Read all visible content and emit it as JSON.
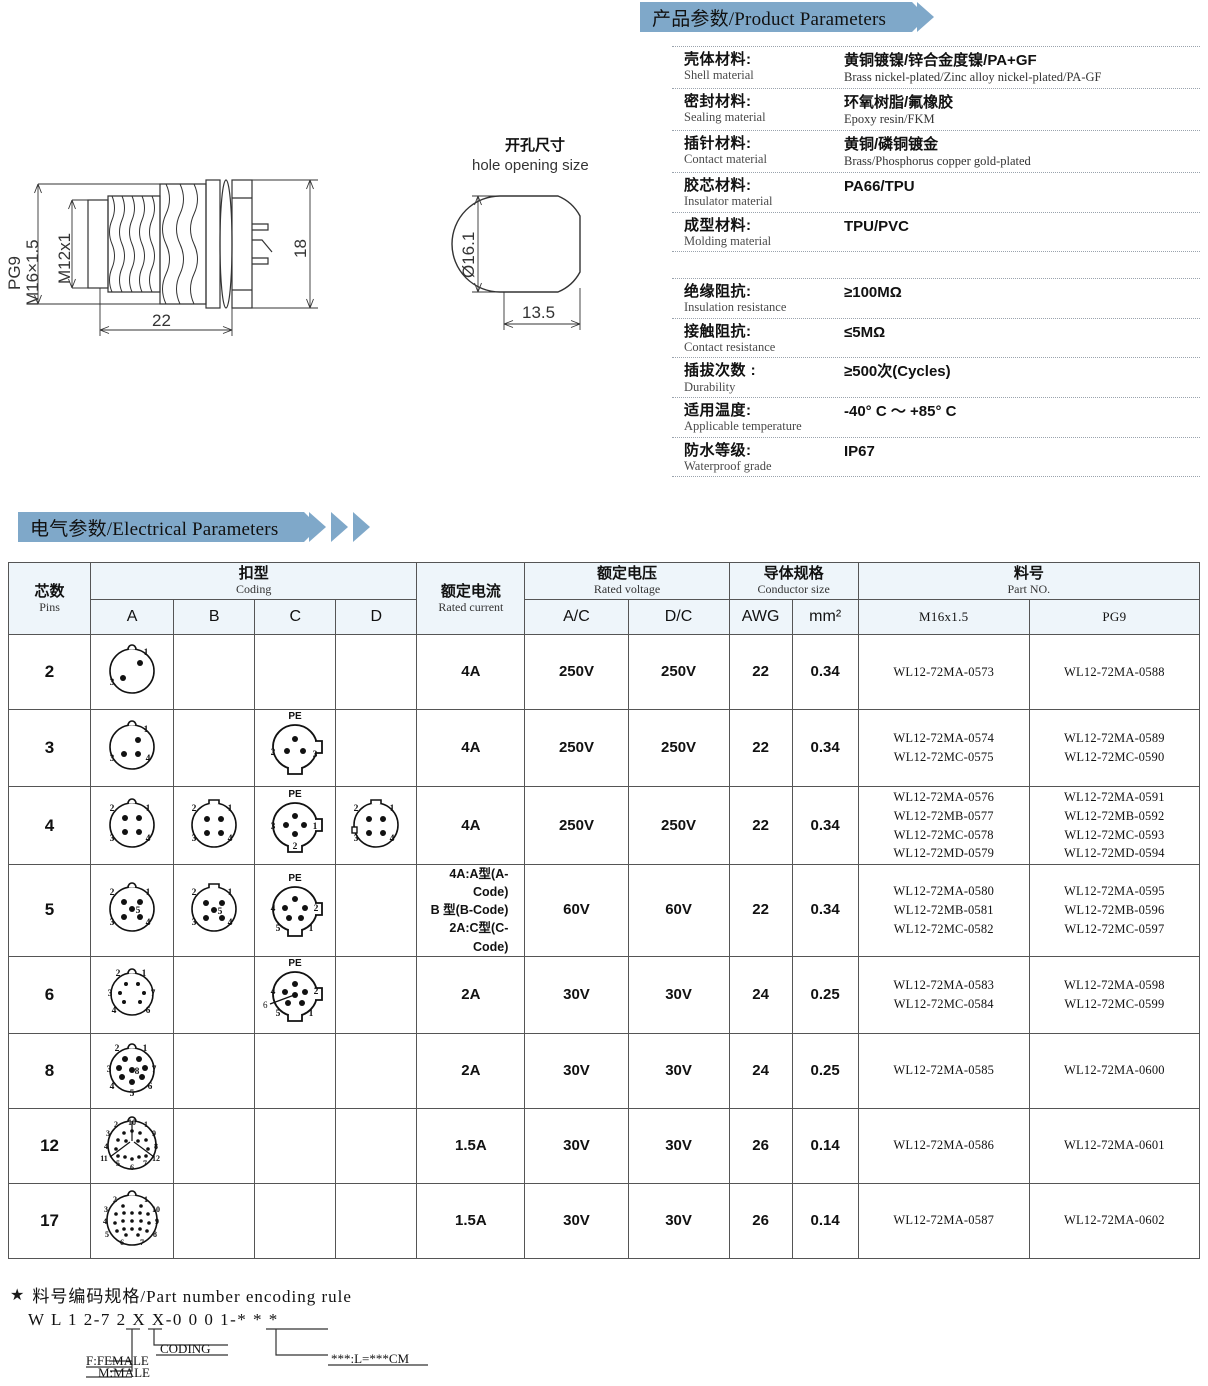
{
  "product_banner": {
    "title": "产品参数/Product Parameters"
  },
  "electrical_banner": {
    "title": "电气参数/Electrical Parameters"
  },
  "materials": [
    {
      "cn": "壳体材料:",
      "en": "Shell material",
      "val_cn": "黄铜镀镍/锌合金度镍/PA+GF",
      "val_en": "Brass nickel-plated/Zinc alloy nickel-plated/PA-GF"
    },
    {
      "cn": "密封材料:",
      "en": "Sealing material",
      "val_cn": "环氧树脂/氟橡胶",
      "val_en": "Epoxy resin/FKM"
    },
    {
      "cn": "插针材料:",
      "en": "Contact material",
      "val_cn": "黄铜/磷铜镀金",
      "val_en": "Brass/Phosphorus copper gold-plated"
    },
    {
      "cn": "胶芯材料:",
      "en": "Insulator material",
      "val_cn": "PA66/TPU",
      "val_en": ""
    },
    {
      "cn": "成型材料:",
      "en": "Molding material",
      "val_cn": "TPU/PVC",
      "val_en": ""
    }
  ],
  "ratings": [
    {
      "cn": "绝缘阻抗:",
      "en": "Insulation resistance",
      "val_cn": "≥100MΩ",
      "val_en": ""
    },
    {
      "cn": "接触阻抗:",
      "en": "Contact resistance",
      "val_cn": "≤5MΩ",
      "val_en": ""
    },
    {
      "cn": "插拔次数 :",
      "en": "Durability",
      "val_cn": "≥500次(Cycles)",
      "val_en": ""
    },
    {
      "cn": "适用温度:",
      "en": "Applicable temperature",
      "val_cn": "-40° C 〜 +85° C",
      "val_en": ""
    },
    {
      "cn": "防水等级:",
      "en": "Waterproof grade",
      "val_cn": "IP67",
      "val_en": ""
    }
  ],
  "drawing_connector": {
    "thread_outer": "PG9",
    "thread_outer2": "M16×1.5",
    "thread_inner": "M12x1",
    "length": "22",
    "height": "18"
  },
  "drawing_hole": {
    "title_cn": "开孔尺寸",
    "title_en": "hole opening size",
    "diameter": "Ø16.1",
    "width": "13.5"
  },
  "table": {
    "headers": {
      "pins_cn": "芯数",
      "pins_en": "Pins",
      "coding_cn": "扣型",
      "coding_en": "Coding",
      "code_a": "A",
      "code_b": "B",
      "code_c": "C",
      "code_d": "D",
      "current_cn": "额定电流",
      "current_en": "Rated current",
      "voltage_cn": "额定电压",
      "voltage_en": "Rated voltage",
      "ac": "A/C",
      "dc": "D/C",
      "conductor_cn": "导体规格",
      "conductor_en": "Conductor size",
      "awg": "AWG",
      "mm2": "mm²",
      "partno_cn": "料号",
      "partno_en": "Part NO.",
      "pn_m16": "M16x1.5",
      "pn_pg9": "PG9"
    },
    "rows": [
      {
        "pins": "2",
        "codes": {
          "A": "2-pin-a",
          "B": "",
          "C": "",
          "D": ""
        },
        "current": "4A",
        "ac": "250V",
        "dc": "250V",
        "awg": "22",
        "mm2": "0.34",
        "pn_m16": [
          "WL12-72MA-0573"
        ],
        "pn_pg9": [
          "WL12-72MA-0588"
        ]
      },
      {
        "pins": "3",
        "codes": {
          "A": "3-pin-a",
          "B": "",
          "C": "3-pin-c-pe",
          "D": ""
        },
        "current": "4A",
        "ac": "250V",
        "dc": "250V",
        "awg": "22",
        "mm2": "0.34",
        "pn_m16": [
          "WL12-72MA-0574",
          "WL12-72MC-0575"
        ],
        "pn_pg9": [
          "WL12-72MA-0589",
          "WL12-72MC-0590"
        ]
      },
      {
        "pins": "4",
        "codes": {
          "A": "4-pin-a",
          "B": "4-pin-b",
          "C": "4-pin-c-pe",
          "D": "4-pin-d"
        },
        "current": "4A",
        "ac": "250V",
        "dc": "250V",
        "awg": "22",
        "mm2": "0.34",
        "pn_m16": [
          "WL12-72MA-0576",
          "WL12-72MB-0577",
          "WL12-72MC-0578",
          "WL12-72MD-0579"
        ],
        "pn_pg9": [
          "WL12-72MA-0591",
          "WL12-72MB-0592",
          "WL12-72MC-0593",
          "WL12-72MD-0594"
        ]
      },
      {
        "pins": "5",
        "codes": {
          "A": "5-pin-a",
          "B": "5-pin-b",
          "C": "5-pin-c-pe",
          "D": ""
        },
        "current_lines": [
          "4A:A型(A-Code)",
          "B 型(B-Code)",
          "2A:C型(C-Code)"
        ],
        "ac": "60V",
        "dc": "60V",
        "awg": "22",
        "mm2": "0.34",
        "pn_m16": [
          "WL12-72MA-0580",
          "WL12-72MB-0581",
          "WL12-72MC-0582"
        ],
        "pn_pg9": [
          "WL12-72MA-0595",
          "WL12-72MB-0596",
          "WL12-72MC-0597"
        ]
      },
      {
        "pins": "6",
        "codes": {
          "A": "6-pin-a",
          "B": "",
          "C": "6-pin-c-pe",
          "D": ""
        },
        "current": "2A",
        "ac": "30V",
        "dc": "30V",
        "awg": "24",
        "mm2": "0.25",
        "pn_m16": [
          "WL12-72MA-0583",
          "WL12-72MC-0584"
        ],
        "pn_pg9": [
          "WL12-72MA-0598",
          "WL12-72MC-0599"
        ]
      },
      {
        "pins": "8",
        "codes": {
          "A": "8-pin-a",
          "B": "",
          "C": "",
          "D": ""
        },
        "current": "2A",
        "ac": "30V",
        "dc": "30V",
        "awg": "24",
        "mm2": "0.25",
        "pn_m16": [
          "WL12-72MA-0585"
        ],
        "pn_pg9": [
          "WL12-72MA-0600"
        ]
      },
      {
        "pins": "12",
        "codes": {
          "A": "12-pin-a",
          "B": "",
          "C": "",
          "D": ""
        },
        "current": "1.5A",
        "ac": "30V",
        "dc": "30V",
        "awg": "26",
        "mm2": "0.14",
        "pn_m16": [
          "WL12-72MA-0586"
        ],
        "pn_pg9": [
          "WL12-72MA-0601"
        ]
      },
      {
        "pins": "17",
        "codes": {
          "A": "17-pin-a",
          "B": "",
          "C": "",
          "D": ""
        },
        "current": "1.5A",
        "ac": "30V",
        "dc": "30V",
        "awg": "26",
        "mm2": "0.14",
        "pn_m16": [
          "WL12-72MA-0587"
        ],
        "pn_pg9": [
          "WL12-72MA-0602"
        ]
      }
    ]
  },
  "encoding": {
    "star": "★",
    "title": "料号编码规格/Part number encoding rule",
    "pattern": "W L 1 2-7 2 X X-0 0 0 1-* * *",
    "note_female": "F:FEMALE",
    "note_male": "M:MALE",
    "note_coding": "CODING",
    "note_length": "***:L=***CM"
  },
  "colors": {
    "banner": "#7fa8c9",
    "header_bg": "#eef5fa",
    "border": "#555555"
  }
}
